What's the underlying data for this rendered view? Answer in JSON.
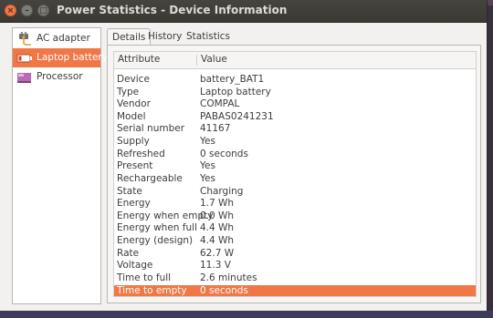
{
  "window": {
    "title": "Power Statistics - Device Information"
  },
  "sidebar": {
    "items": [
      {
        "label": "AC adapter",
        "icon": "ac-adapter-icon"
      },
      {
        "label": "Laptop battery",
        "icon": "battery-icon"
      },
      {
        "label": "Processor",
        "icon": "processor-icon"
      }
    ],
    "selected_index": 1
  },
  "tabs": [
    {
      "label": "Details"
    },
    {
      "label": "History"
    },
    {
      "label": "Statistics"
    }
  ],
  "table": {
    "columns": [
      "Attribute",
      "Value"
    ],
    "rows": [
      {
        "attribute": "Device",
        "value": "battery_BAT1"
      },
      {
        "attribute": "Type",
        "value": "Laptop battery"
      },
      {
        "attribute": "Vendor",
        "value": "COMPAL"
      },
      {
        "attribute": "Model",
        "value": "PABAS0241231"
      },
      {
        "attribute": "Serial number",
        "value": "41167"
      },
      {
        "attribute": "Supply",
        "value": "Yes"
      },
      {
        "attribute": "Refreshed",
        "value": "0 seconds"
      },
      {
        "attribute": "Present",
        "value": "Yes"
      },
      {
        "attribute": "Rechargeable",
        "value": "Yes"
      },
      {
        "attribute": "State",
        "value": "Charging"
      },
      {
        "attribute": "Energy",
        "value": "1.7 Wh"
      },
      {
        "attribute": "Energy when empty",
        "value": "0.0 Wh"
      },
      {
        "attribute": "Energy when full",
        "value": "4.4 Wh"
      },
      {
        "attribute": "Energy (design)",
        "value": "4.4 Wh"
      },
      {
        "attribute": "Rate",
        "value": "62.7 W"
      },
      {
        "attribute": "Voltage",
        "value": "11.3 V"
      },
      {
        "attribute": "Time to full",
        "value": "2.6 minutes"
      },
      {
        "attribute": "Time to empty",
        "value": "0 seconds"
      }
    ],
    "selected_row": 17
  },
  "colors": {
    "accent": "#f07746",
    "titlebar": "#3c3b37"
  }
}
